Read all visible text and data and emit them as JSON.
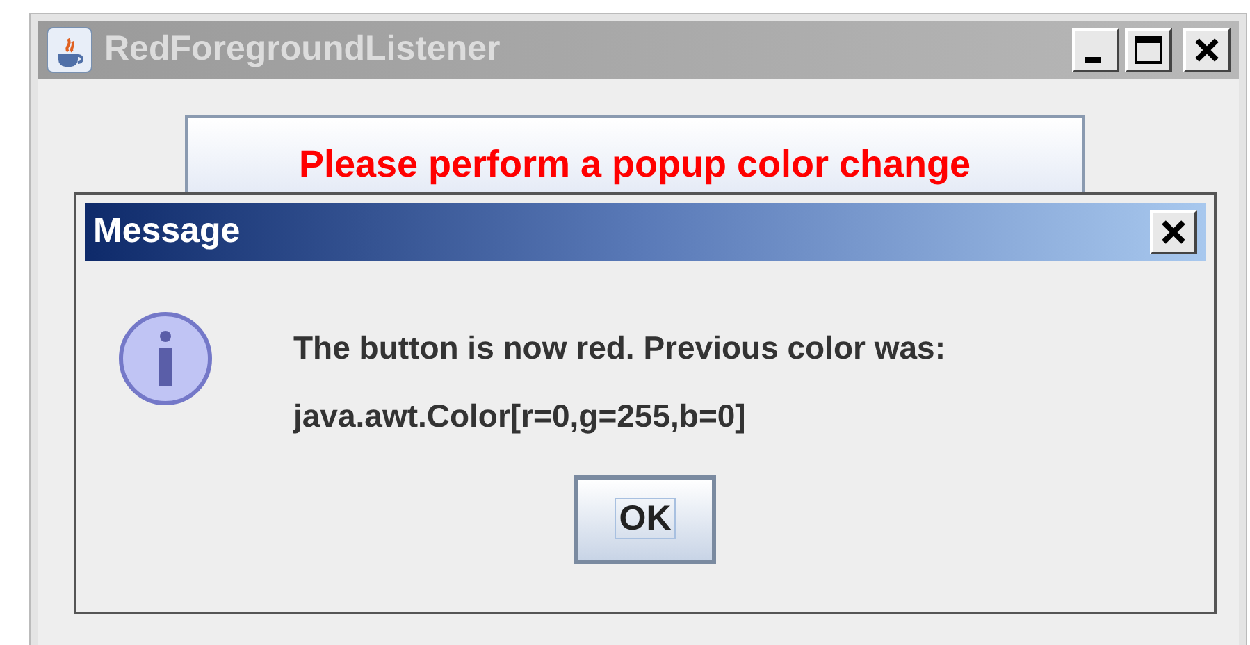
{
  "window": {
    "title": "RedForegroundListener",
    "active": false
  },
  "main_button": {
    "label": "Please perform a popup color change"
  },
  "dialog": {
    "title": "Message",
    "active": true,
    "message_lines": [
      "The button is now red. Previous color was:",
      "java.awt.Color[r=0,g=255,b=0]"
    ],
    "buttons": [
      {
        "label": "OK",
        "focused": true
      }
    ]
  }
}
